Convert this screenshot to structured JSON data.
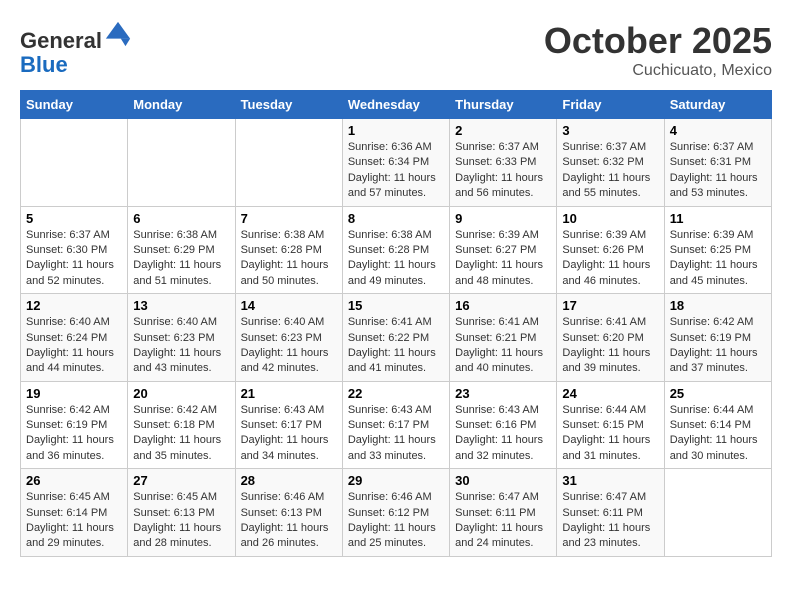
{
  "header": {
    "logo_line1": "General",
    "logo_line2": "Blue",
    "month": "October 2025",
    "location": "Cuchicuato, Mexico"
  },
  "days_of_week": [
    "Sunday",
    "Monday",
    "Tuesday",
    "Wednesday",
    "Thursday",
    "Friday",
    "Saturday"
  ],
  "weeks": [
    [
      {
        "day": "",
        "info": ""
      },
      {
        "day": "",
        "info": ""
      },
      {
        "day": "",
        "info": ""
      },
      {
        "day": "1",
        "info": "Sunrise: 6:36 AM\nSunset: 6:34 PM\nDaylight: 11 hours\nand 57 minutes."
      },
      {
        "day": "2",
        "info": "Sunrise: 6:37 AM\nSunset: 6:33 PM\nDaylight: 11 hours\nand 56 minutes."
      },
      {
        "day": "3",
        "info": "Sunrise: 6:37 AM\nSunset: 6:32 PM\nDaylight: 11 hours\nand 55 minutes."
      },
      {
        "day": "4",
        "info": "Sunrise: 6:37 AM\nSunset: 6:31 PM\nDaylight: 11 hours\nand 53 minutes."
      }
    ],
    [
      {
        "day": "5",
        "info": "Sunrise: 6:37 AM\nSunset: 6:30 PM\nDaylight: 11 hours\nand 52 minutes."
      },
      {
        "day": "6",
        "info": "Sunrise: 6:38 AM\nSunset: 6:29 PM\nDaylight: 11 hours\nand 51 minutes."
      },
      {
        "day": "7",
        "info": "Sunrise: 6:38 AM\nSunset: 6:28 PM\nDaylight: 11 hours\nand 50 minutes."
      },
      {
        "day": "8",
        "info": "Sunrise: 6:38 AM\nSunset: 6:28 PM\nDaylight: 11 hours\nand 49 minutes."
      },
      {
        "day": "9",
        "info": "Sunrise: 6:39 AM\nSunset: 6:27 PM\nDaylight: 11 hours\nand 48 minutes."
      },
      {
        "day": "10",
        "info": "Sunrise: 6:39 AM\nSunset: 6:26 PM\nDaylight: 11 hours\nand 46 minutes."
      },
      {
        "day": "11",
        "info": "Sunrise: 6:39 AM\nSunset: 6:25 PM\nDaylight: 11 hours\nand 45 minutes."
      }
    ],
    [
      {
        "day": "12",
        "info": "Sunrise: 6:40 AM\nSunset: 6:24 PM\nDaylight: 11 hours\nand 44 minutes."
      },
      {
        "day": "13",
        "info": "Sunrise: 6:40 AM\nSunset: 6:23 PM\nDaylight: 11 hours\nand 43 minutes."
      },
      {
        "day": "14",
        "info": "Sunrise: 6:40 AM\nSunset: 6:23 PM\nDaylight: 11 hours\nand 42 minutes."
      },
      {
        "day": "15",
        "info": "Sunrise: 6:41 AM\nSunset: 6:22 PM\nDaylight: 11 hours\nand 41 minutes."
      },
      {
        "day": "16",
        "info": "Sunrise: 6:41 AM\nSunset: 6:21 PM\nDaylight: 11 hours\nand 40 minutes."
      },
      {
        "day": "17",
        "info": "Sunrise: 6:41 AM\nSunset: 6:20 PM\nDaylight: 11 hours\nand 39 minutes."
      },
      {
        "day": "18",
        "info": "Sunrise: 6:42 AM\nSunset: 6:19 PM\nDaylight: 11 hours\nand 37 minutes."
      }
    ],
    [
      {
        "day": "19",
        "info": "Sunrise: 6:42 AM\nSunset: 6:19 PM\nDaylight: 11 hours\nand 36 minutes."
      },
      {
        "day": "20",
        "info": "Sunrise: 6:42 AM\nSunset: 6:18 PM\nDaylight: 11 hours\nand 35 minutes."
      },
      {
        "day": "21",
        "info": "Sunrise: 6:43 AM\nSunset: 6:17 PM\nDaylight: 11 hours\nand 34 minutes."
      },
      {
        "day": "22",
        "info": "Sunrise: 6:43 AM\nSunset: 6:17 PM\nDaylight: 11 hours\nand 33 minutes."
      },
      {
        "day": "23",
        "info": "Sunrise: 6:43 AM\nSunset: 6:16 PM\nDaylight: 11 hours\nand 32 minutes."
      },
      {
        "day": "24",
        "info": "Sunrise: 6:44 AM\nSunset: 6:15 PM\nDaylight: 11 hours\nand 31 minutes."
      },
      {
        "day": "25",
        "info": "Sunrise: 6:44 AM\nSunset: 6:14 PM\nDaylight: 11 hours\nand 30 minutes."
      }
    ],
    [
      {
        "day": "26",
        "info": "Sunrise: 6:45 AM\nSunset: 6:14 PM\nDaylight: 11 hours\nand 29 minutes."
      },
      {
        "day": "27",
        "info": "Sunrise: 6:45 AM\nSunset: 6:13 PM\nDaylight: 11 hours\nand 28 minutes."
      },
      {
        "day": "28",
        "info": "Sunrise: 6:46 AM\nSunset: 6:13 PM\nDaylight: 11 hours\nand 26 minutes."
      },
      {
        "day": "29",
        "info": "Sunrise: 6:46 AM\nSunset: 6:12 PM\nDaylight: 11 hours\nand 25 minutes."
      },
      {
        "day": "30",
        "info": "Sunrise: 6:47 AM\nSunset: 6:11 PM\nDaylight: 11 hours\nand 24 minutes."
      },
      {
        "day": "31",
        "info": "Sunrise: 6:47 AM\nSunset: 6:11 PM\nDaylight: 11 hours\nand 23 minutes."
      },
      {
        "day": "",
        "info": ""
      }
    ]
  ]
}
